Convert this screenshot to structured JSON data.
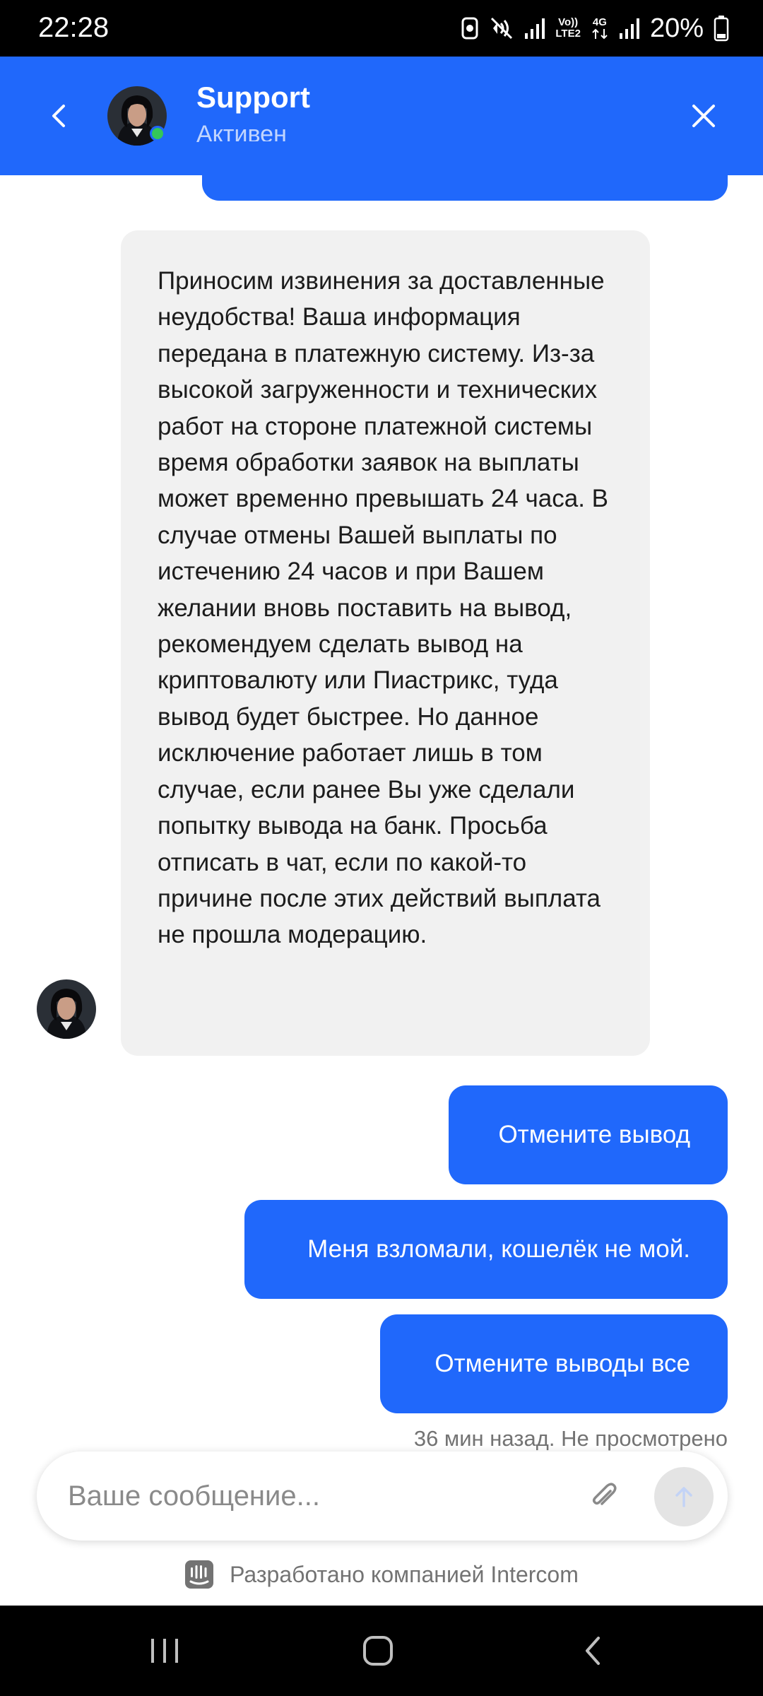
{
  "status_bar": {
    "time": "22:28",
    "network_label_top": "Vo))",
    "network_label_bottom": "LTE2",
    "network_type": "4G",
    "battery_percent": "20%",
    "icons": [
      "data-saver-icon",
      "vibrate-mute-icon",
      "signal-icon",
      "volte-icon",
      "4g-icon",
      "signal-icon",
      "battery-icon"
    ]
  },
  "header": {
    "title": "Support",
    "status": "Активен",
    "accent_color": "#2068fb"
  },
  "messages": {
    "agent": {
      "text": "Приносим извинения за доставленные неудобства! Ваша информация передана в платежную систему. Из-за высокой загруженности и технических работ на стороне платежной системы время обработки заявок на выплаты может временно превышать 24 часа. В случае отмены Вашей выплаты по истечению 24 часов и при Вашем желании вновь поставить на вывод, рекомендуем сделать вывод на криптовалюту или Пиастрикс, туда вывод будет быстрее. Но данное исключение работает лишь в том случае, если ранее Вы уже сделали попытку вывода на банк. Просьба отписать в чат, если по какой-то причине после этих действий выплата не прошла модерацию."
    },
    "user": [
      {
        "text": "Отмените вывод"
      },
      {
        "text": "Меня взломали, кошелёк не мой."
      },
      {
        "text": "Отмените выводы все"
      }
    ],
    "meta": "36 мин назад. Не просмотрено"
  },
  "composer": {
    "placeholder": "Ваше сообщение...",
    "value": ""
  },
  "branding": {
    "text": "Разработано компанией Intercom"
  }
}
